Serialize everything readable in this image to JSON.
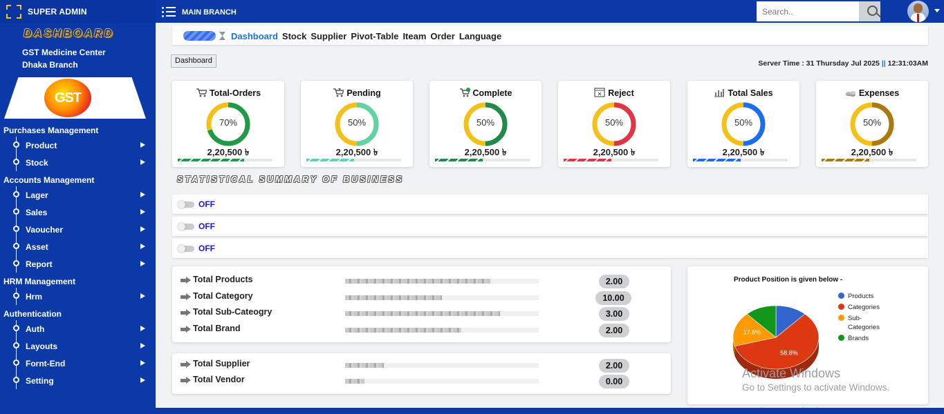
{
  "sidebar": {
    "brand": "SUPER ADMIN",
    "dashboard_label": "DASHBOARD",
    "org_line1": "GST Medicine Center",
    "org_line2": "Dhaka Branch",
    "logo_text": "GST",
    "sections": [
      {
        "title": "Purchases Management",
        "items": [
          "Product",
          "Stock"
        ]
      },
      {
        "title": "Accounts Management",
        "items": [
          "Lager",
          "Sales",
          "Vaoucher",
          "Asset",
          "Report"
        ]
      },
      {
        "title": "HRM Management",
        "items": [
          "Hrm"
        ]
      },
      {
        "title": "Authentication",
        "items": [
          "Auth",
          "Layouts",
          "Fornt-End",
          "Setting"
        ]
      }
    ]
  },
  "topbar": {
    "branch": "MAIN BRANCH",
    "search_placeholder": "Search.."
  },
  "nav": {
    "links": [
      "Dashboard",
      "Stock",
      "Supplier",
      "Pivot-Table",
      "Iteam",
      "Order",
      "Language"
    ],
    "active": "Dashboard"
  },
  "dashboard_button": "Dashboard",
  "server_time": {
    "label": "Server Time :",
    "date": "31 Thursday Jul 2025",
    "separator": "||",
    "time": "12:31:03AM"
  },
  "stat_cards": [
    {
      "title": "Total-Orders",
      "percent_label": "70%",
      "percent": 70,
      "amount": "2,20,500 ৳",
      "color": "#1e9a4a",
      "icon": "cart-icon"
    },
    {
      "title": "Pending",
      "percent_label": "50%",
      "percent": 50,
      "amount": "2,20,500 ৳",
      "color": "#5fd3a8",
      "icon": "cart-hourglass-icon"
    },
    {
      "title": "Complete",
      "percent_label": "50%",
      "percent": 50,
      "amount": "2,20,500 ৳",
      "color": "#1f8a4e",
      "icon": "cart-check-icon"
    },
    {
      "title": "Reject",
      "percent_label": "50%",
      "percent": 50,
      "amount": "2,20,500 ৳",
      "color": "#e03545",
      "icon": "calendar-x-icon"
    },
    {
      "title": "Total Sales",
      "percent_label": "50%",
      "percent": 50,
      "amount": "2,20,500 ৳",
      "color": "#1a6ef0",
      "icon": "bar-chart-icon"
    },
    {
      "title": "Expenses",
      "percent_label": "50%",
      "percent": 50,
      "amount": "2,20,500 ৳",
      "color": "#a87a12",
      "icon": "coins-icon"
    }
  ],
  "ring_track_color": "#f5c118",
  "summary_title": "STATISTICAL SUMMARY OF BUSINESS",
  "toggles": [
    {
      "label": "OFF",
      "on": false
    },
    {
      "label": "OFF",
      "on": false
    },
    {
      "label": "OFF",
      "on": false
    }
  ],
  "totals": [
    {
      "name": "Total Products",
      "value": "2.00",
      "fill": 0.75
    },
    {
      "name": "Total Category",
      "value": "10.00",
      "fill": 0.5
    },
    {
      "name": "Total Sub-Cateogry",
      "value": "3.00",
      "fill": 0.8
    },
    {
      "name": "Total Brand",
      "value": "2.00",
      "fill": 0.6
    }
  ],
  "totals2": [
    {
      "name": "Total Supplier",
      "value": "2.00",
      "fill": 0.2
    },
    {
      "name": "Total Vendor",
      "value": "0.00",
      "fill": 0.1
    }
  ],
  "pie": {
    "title": "Product Position is given below -",
    "slices": [
      {
        "name": "Products",
        "value": 11.8,
        "color": "#3366cc",
        "label": ""
      },
      {
        "name": "Categories",
        "value": 58.8,
        "color": "#dc3912",
        "label": "58.8%"
      },
      {
        "name": "Sub-Categories",
        "value": 17.6,
        "color": "#ff9900",
        "label": "17.6%"
      },
      {
        "name": "Brands",
        "value": 11.8,
        "color": "#109618",
        "label": ""
      }
    ]
  },
  "chart_data": {
    "type": "pie",
    "title": "Product Position is given below -",
    "categories": [
      "Products",
      "Categories",
      "Sub-Categories",
      "Brands"
    ],
    "values": [
      11.8,
      58.8,
      17.6,
      11.8
    ],
    "legend": "right"
  },
  "watermark": {
    "line1": "Activate Windows",
    "line2": "Go to Settings to activate Windows.",
    "line3": "Activate Windows"
  }
}
